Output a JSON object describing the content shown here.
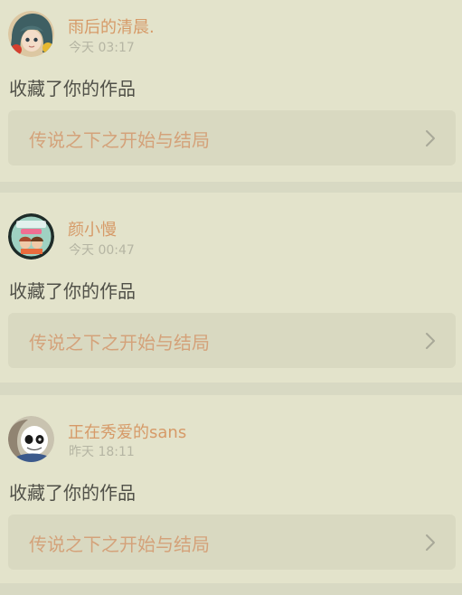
{
  "feed": {
    "items": [
      {
        "user_name": "雨后的清晨.",
        "timestamp": "今天 03:17",
        "action_text": "收藏了你的作品",
        "work_title": "传说之下之开始与结局",
        "avatar_icon": "anime-girl-avatar-icon"
      },
      {
        "user_name": "颜小慢",
        "timestamp": "今天 00:47",
        "action_text": "收藏了你的作品",
        "work_title": "传说之下之开始与结局",
        "avatar_icon": "cartoon-avatar-icon"
      },
      {
        "user_name": "正在秀爱的sans",
        "timestamp": "昨天 18:11",
        "action_text": "收藏了你的作品",
        "work_title": "传说之下之开始与结局",
        "avatar_icon": "sans-avatar-icon"
      }
    ]
  },
  "colors": {
    "page_background": "#d8d9c3",
    "card_background": "#e3e3cb",
    "link_background": "#d9d9c1",
    "username": "#d69a68",
    "work_title": "#d4a27a",
    "action_text": "#505048",
    "timestamp": "#b5b5a3",
    "chevron": "#a8a898"
  }
}
